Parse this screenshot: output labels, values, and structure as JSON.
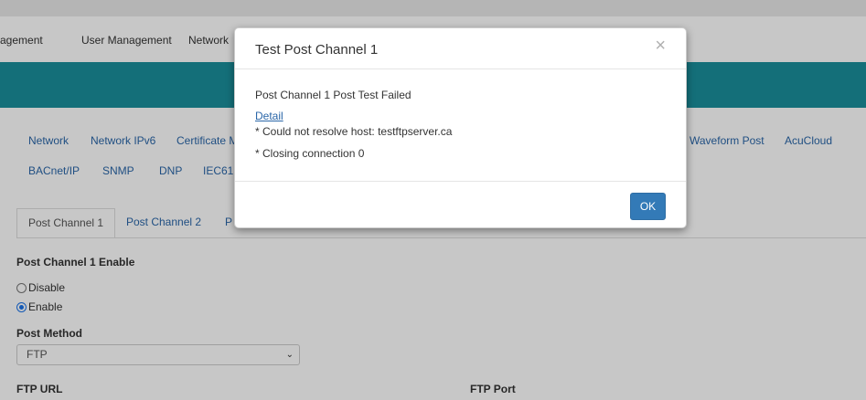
{
  "top_nav": {
    "items": [
      "agement",
      "User Management",
      "Network"
    ]
  },
  "sub_nav": {
    "row1": [
      "Network",
      "Network IPv6",
      "Certificate M",
      "Waveform Post",
      "AcuCloud"
    ],
    "row2": [
      "BACnet/IP",
      "SNMP",
      "DNP",
      "IEC61"
    ]
  },
  "tabs": [
    "Post Channel 1",
    "Post Channel 2",
    "P"
  ],
  "form": {
    "enable_label": "Post Channel 1 Enable",
    "options": [
      "Disable",
      "Enable"
    ],
    "selected_option": "Enable",
    "method_label": "Post Method",
    "method_value": "FTP",
    "ftp_url_label": "FTP URL",
    "ftp_port_label": "FTP Port"
  },
  "modal": {
    "title": "Test Post Channel 1",
    "close_symbol": "×",
    "message": "Post Channel 1 Post Test Failed",
    "detail_link": "Detail",
    "detail_lines": [
      "* Could not resolve host: testftpserver.ca",
      "* Closing connection 0"
    ],
    "ok_label": "OK"
  },
  "colors": {
    "banner": "#1a8f9b",
    "link": "#2a66a8",
    "primary_button": "#337ab7",
    "radio_checked": "#1a73e8"
  },
  "icons": {
    "close": "close-icon",
    "select_caret": "chevron-down-icon"
  }
}
